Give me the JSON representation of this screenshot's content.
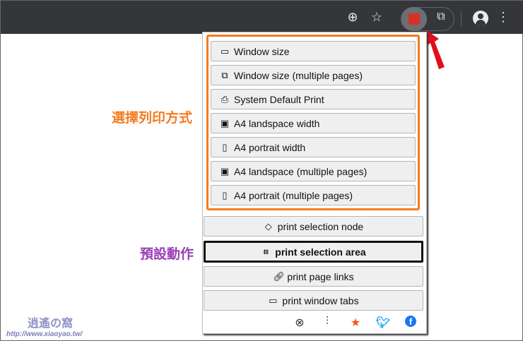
{
  "toolbar": {
    "zoom_icon": "zoom-in-icon",
    "bookmark_icon": "star-icon",
    "extension_icon": "print-extension-icon",
    "extensions_icon": "puzzle-icon",
    "profile_icon": "avatar-icon",
    "menu_icon": "more-vert-icon"
  },
  "print_modes": [
    {
      "label": "Window size",
      "icon": "window-icon"
    },
    {
      "label": "Window size (multiple pages)",
      "icon": "windows-icon"
    },
    {
      "label": "System Default Print",
      "icon": "printer-icon"
    },
    {
      "label": "A4 landspace width",
      "icon": "image-icon"
    },
    {
      "label": "A4 portrait width",
      "icon": "portrait-icon"
    },
    {
      "label": "A4 landspace (multiple pages)",
      "icon": "images-icon"
    },
    {
      "label": "A4 portrait (multiple pages)",
      "icon": "portraits-icon"
    }
  ],
  "actions": [
    {
      "label": "print selection node",
      "icon": "eraser-icon"
    },
    {
      "label": "print selection area",
      "icon": "crop-icon",
      "selected": true
    },
    {
      "label": "print page links",
      "icon": "link-icon"
    },
    {
      "label": "print window tabs",
      "icon": "window-icon"
    }
  ],
  "footer": {
    "icons": [
      "close-circle-icon",
      "sliders-icon",
      "star-icon",
      "twitter-icon",
      "facebook-icon"
    ],
    "star_color": "#f4511e",
    "twitter_color": "#1da1f2",
    "facebook_color": "#1877f2"
  },
  "annotations": {
    "print_modes_label": "選擇列印方式",
    "default_action_label": "預設動作",
    "orange": "#f47b20",
    "purple": "#9b3fb5"
  },
  "watermark": {
    "logo": "逍遙の窩",
    "url": "http://www.xiaoyao.tw/"
  }
}
